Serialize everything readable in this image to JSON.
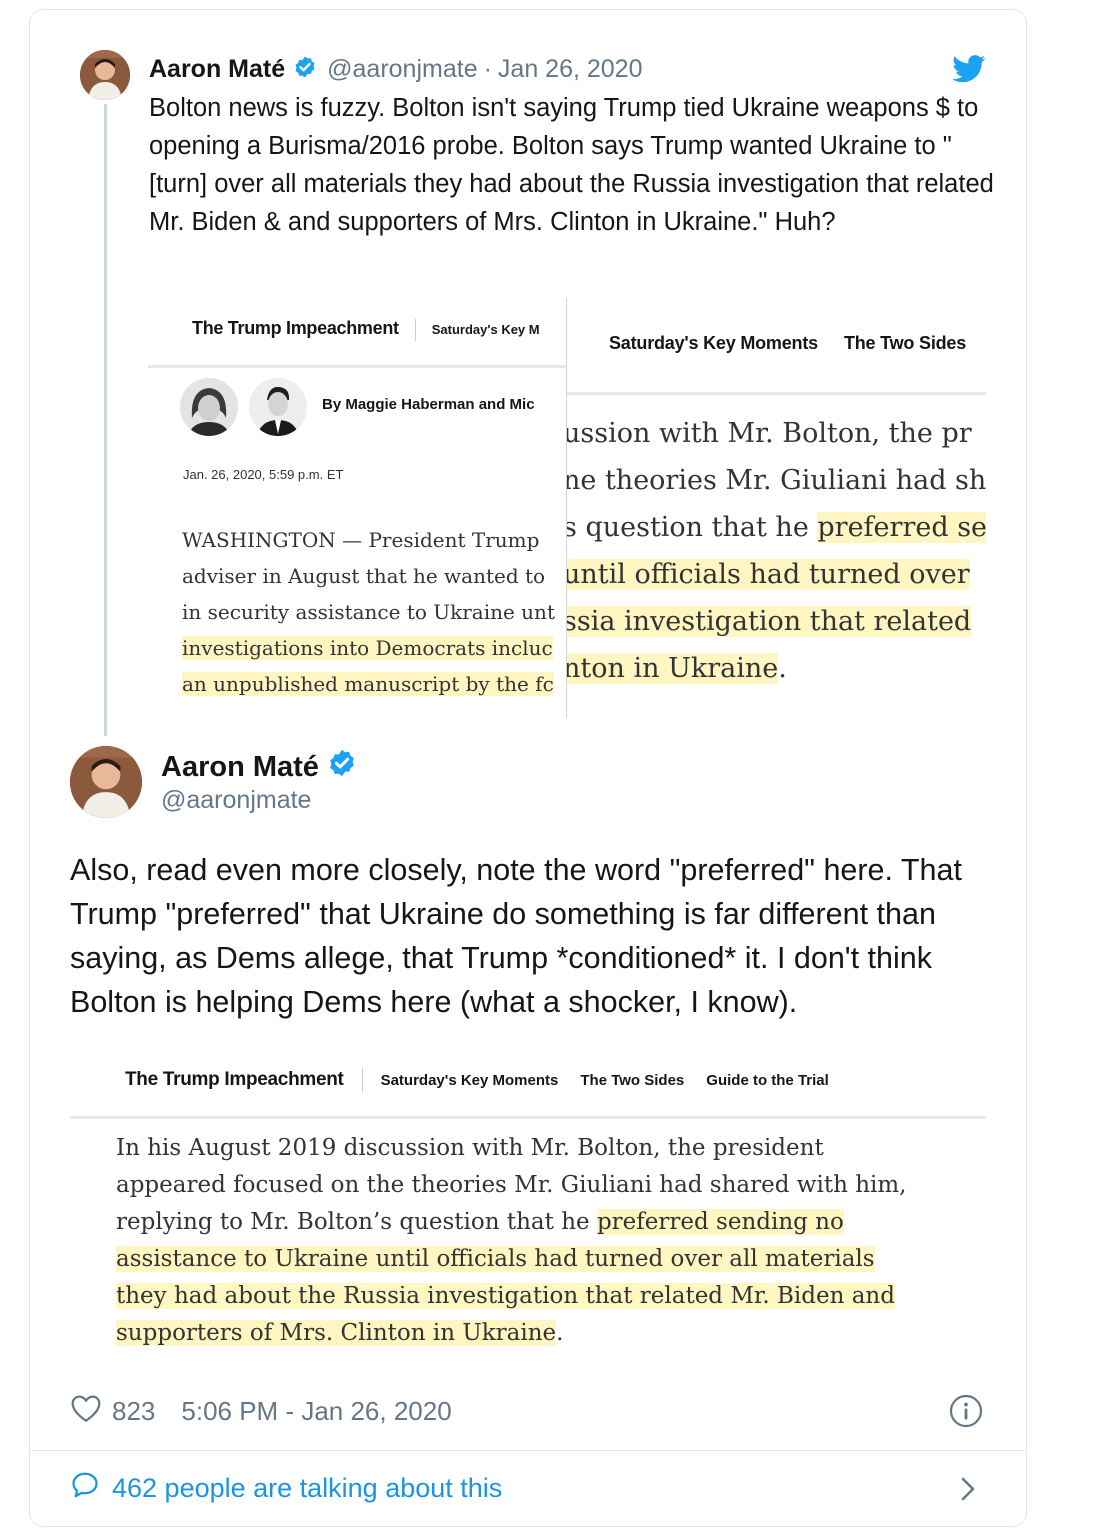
{
  "parent_tweet": {
    "name": "Aaron Maté",
    "handle": "@aaronjmate",
    "separator": "·",
    "date": "Jan 26, 2020",
    "text": "Bolton news is fuzzy. Bolton isn't saying Trump tied Ukraine weapons $ to opening a Burisma/2016 probe. Bolton says Trump wanted Ukraine to \"[turn] over all materials they had about the Russia investigation that related Mr. Biden & and supporters of Mrs. Clinton in Ukraine.\" Huh?",
    "image": {
      "left": {
        "section_title": "The Trump Impeachment",
        "nav_item": "Saturday's Key M",
        "byline": "By Maggie Haberman and Mic",
        "dateline": "Jan. 26, 2020, 5:59 p.m. ET",
        "lines": [
          {
            "text": "WASHINGTON — President Trump",
            "highlight": false
          },
          {
            "text": "adviser in August that he wanted to",
            "highlight": false
          },
          {
            "text": "in security assistance to Ukraine unt",
            "highlight": false
          },
          {
            "text": "investigations into Democrats incluc",
            "highlight": true
          },
          {
            "text": "an unpublished manuscript by the fc",
            "highlight": true
          }
        ]
      },
      "right": {
        "nav_items": [
          "Saturday's Key Moments",
          "The Two Sides"
        ],
        "lines": [
          {
            "plain": "ussion with Mr. Bolton, the pr",
            "hl": ""
          },
          {
            "plain": "ne theories Mr. Giuliani had sh",
            "hl": ""
          },
          {
            "plain": "s question that he ",
            "hl": "preferred se"
          },
          {
            "plain": "",
            "hl": "until officials had turned over"
          },
          {
            "plain": "",
            "hl": "ssia investigation that related"
          },
          {
            "plain": "",
            "hl": "nton in Ukraine",
            "tail": "."
          }
        ]
      }
    }
  },
  "main_tweet": {
    "name": "Aaron Maté",
    "handle": "@aaronjmate",
    "text": "Also, read even more closely, note the word \"preferred\" here. That Trump \"preferred\" that Ukraine do something is far different than saying, as Dems allege, that Trump *conditioned* it. I don't think Bolton is helping Dems here (what a shocker, I know).",
    "image": {
      "section_title": "The Trump Impeachment",
      "nav_items": [
        "Saturday's Key Moments",
        "The Two Sides",
        "Guide to the Trial"
      ],
      "lines": [
        {
          "plain": "In his August 2019 discussion with Mr. Bolton, the president",
          "hl": ""
        },
        {
          "plain": "appeared focused on the theories Mr. Giuliani had shared with him,",
          "hl": ""
        },
        {
          "plain": "replying to Mr. Bolton’s question that he ",
          "hl": "preferred sending no"
        },
        {
          "plain": "",
          "hl": "assistance to Ukraine until officials had turned over all materials"
        },
        {
          "plain": "",
          "hl": "they had about the Russia investigation that related Mr. Biden and"
        },
        {
          "plain": "",
          "hl": "supporters of Mrs. Clinton in Ukraine",
          "tail": "."
        }
      ]
    },
    "likes": "823",
    "timestamp": "5:06 PM - Jan 26, 2020"
  },
  "footer": {
    "talking": "462 people are talking about this"
  },
  "colors": {
    "twitter_blue": "#1da1f2",
    "link_blue": "#1b95e0",
    "highlight": "#fff6c2",
    "muted": "#657786"
  },
  "icons": [
    "verified-badge-icon",
    "twitter-bird-icon",
    "heart-icon",
    "info-icon",
    "reply-bubble-icon",
    "chevron-right-icon"
  ]
}
